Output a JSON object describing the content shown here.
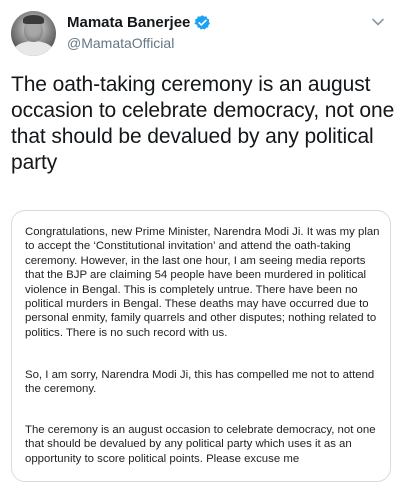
{
  "author": {
    "display_name": "Mamata Banerjee",
    "handle": "@MamataOfficial",
    "verified": true
  },
  "icons": {
    "avatar": "profile-photo",
    "verified": "verified-badge-icon",
    "more": "chevron-down-icon"
  },
  "colors": {
    "verified_blue": "#1da1f2",
    "handle_gray": "#657786",
    "text": "#14171a",
    "card_border": "#d7dbe0"
  },
  "tweet": {
    "text": "The oath-taking ceremony is an august occasion to celebrate democracy, not one that should be devalued by any political party"
  },
  "attachment": {
    "paragraphs": [
      "Congratulations, new Prime Minister, Narendra Modi Ji. It was my plan to accept the ‘Constitutional invitation’ and attend the oath-taking ceremony. However, in the last one hour, I am seeing media reports that the BJP are claiming 54 people have been murdered in political violence in Bengal. This is completely untrue. There have been no political murders in Bengal. These deaths may have occurred due to personal enmity, family quarrels and other disputes; nothing related to politics. There is no such record with us.",
      "So, I am sorry, Narendra Modi Ji, this has compelled me not to attend the ceremony.",
      "The ceremony is an august occasion to celebrate democracy, not one that should be devalued by any political party which uses it as an opportunity to score political points. Please excuse me"
    ]
  }
}
